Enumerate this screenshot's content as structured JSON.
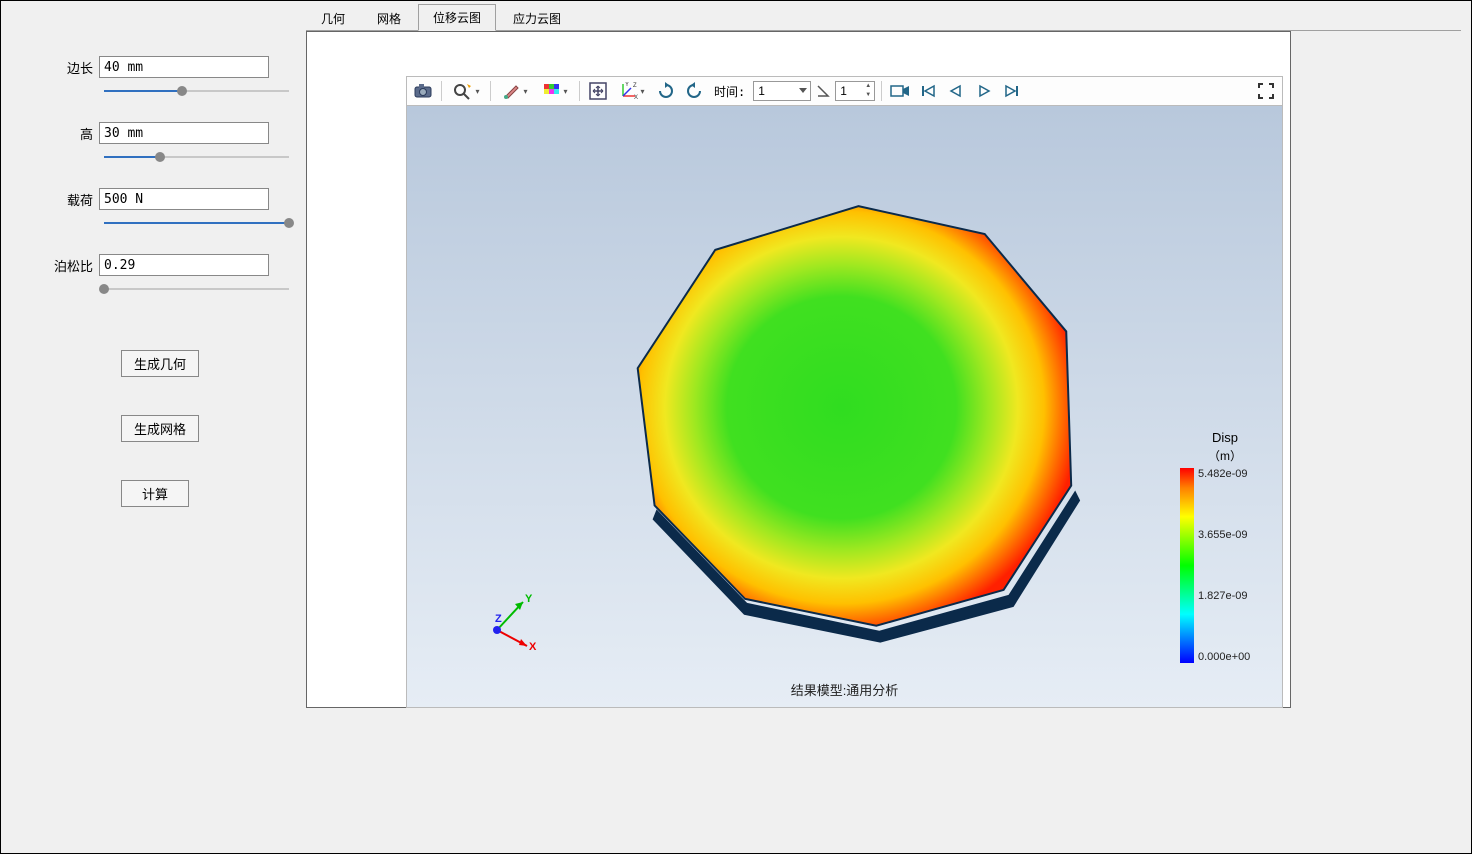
{
  "sidebar": {
    "params": [
      {
        "label": "边长",
        "value": "40 mm",
        "slider_pct": 42
      },
      {
        "label": "高",
        "value": "30 mm",
        "slider_pct": 30
      },
      {
        "label": "载荷",
        "value": "500 N",
        "slider_pct": 100
      },
      {
        "label": "泊松比",
        "value": "0.29",
        "slider_pct": 0
      }
    ],
    "buttons": {
      "gen_geom": "生成几何",
      "gen_mesh": "生成网格",
      "compute": "计算"
    }
  },
  "tabs": [
    {
      "label": "几何",
      "active": false
    },
    {
      "label": "网格",
      "active": false
    },
    {
      "label": "位移云图",
      "active": true
    },
    {
      "label": "应力云图",
      "active": false
    }
  ],
  "toolbar": {
    "time_label": "时间:",
    "time_value": "1",
    "step_value": "1"
  },
  "viewport": {
    "caption": "结果模型:通用分析",
    "axes": {
      "x": "X",
      "y": "Y",
      "z": "Z"
    }
  },
  "legend": {
    "title": "Disp",
    "unit": "（m）",
    "ticks": [
      "5.482e-09",
      "3.655e-09",
      "1.827e-09",
      "0.000e+00"
    ]
  }
}
